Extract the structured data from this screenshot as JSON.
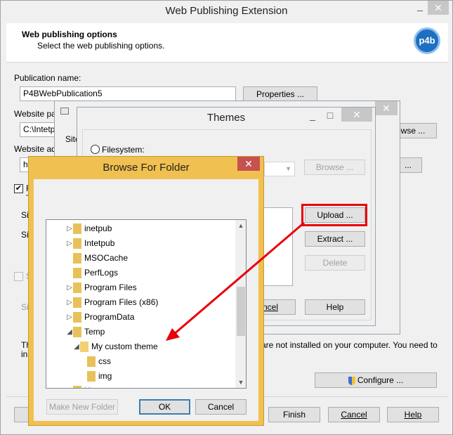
{
  "main": {
    "title": "Web Publishing Extension",
    "header_title": "Web publishing options",
    "header_subtitle": "Select the web publishing options.",
    "logo_text": "p4b",
    "publication_label": "Publication name:",
    "publication_value": "P4BWebPublication5",
    "properties_button": "Properties ...",
    "website_path_label": "Website pa",
    "website_path_value": "C:\\Intetp",
    "browse_button_partial": "owse ...",
    "website_address_label": "Website ad",
    "website_address_value": "ht",
    "checkbox_label": "R",
    "checkbox_line2": "T",
    "site_label_1": "Sit",
    "site_label_2": "Sit",
    "site_label_3": "Sit",
    "s_label": "S",
    "note_start": "Th",
    "note_start2": "ins",
    "note_text": "are not installed on your computer. You need to",
    "configure_button": "Configure ...",
    "finish_button": "Finish",
    "cancel_button": "Cancel",
    "help_button": "Help",
    "close_icon": "x"
  },
  "themes": {
    "title": "Themes",
    "filesystem_label": "Filesystem:",
    "browse_button": "Browse ...",
    "upload_button": "Upload ...",
    "extract_button": "Extract ...",
    "delete_button": "Delete",
    "cancel_partial": "ncel",
    "help_button": "Help"
  },
  "browse": {
    "title": "Browse For Folder",
    "tree": [
      {
        "name": "inetpub"
      },
      {
        "name": "Intetpub"
      },
      {
        "name": "MSOCache"
      },
      {
        "name": "PerfLogs"
      },
      {
        "name": "Program Files"
      },
      {
        "name": "Program Files (x86)"
      },
      {
        "name": "ProgramData"
      },
      {
        "name": "Temp"
      },
      {
        "name": "My custom theme"
      },
      {
        "name": "css"
      },
      {
        "name": "img"
      },
      {
        "name": "U"
      }
    ],
    "make_new_folder": "Make New Folder",
    "ok_button": "OK",
    "cancel_button": "Cancel"
  },
  "colors": {
    "highlight_red": "#e8000b",
    "folder_yellow": "#e8c15a",
    "dialog_border": "#f0c050"
  }
}
